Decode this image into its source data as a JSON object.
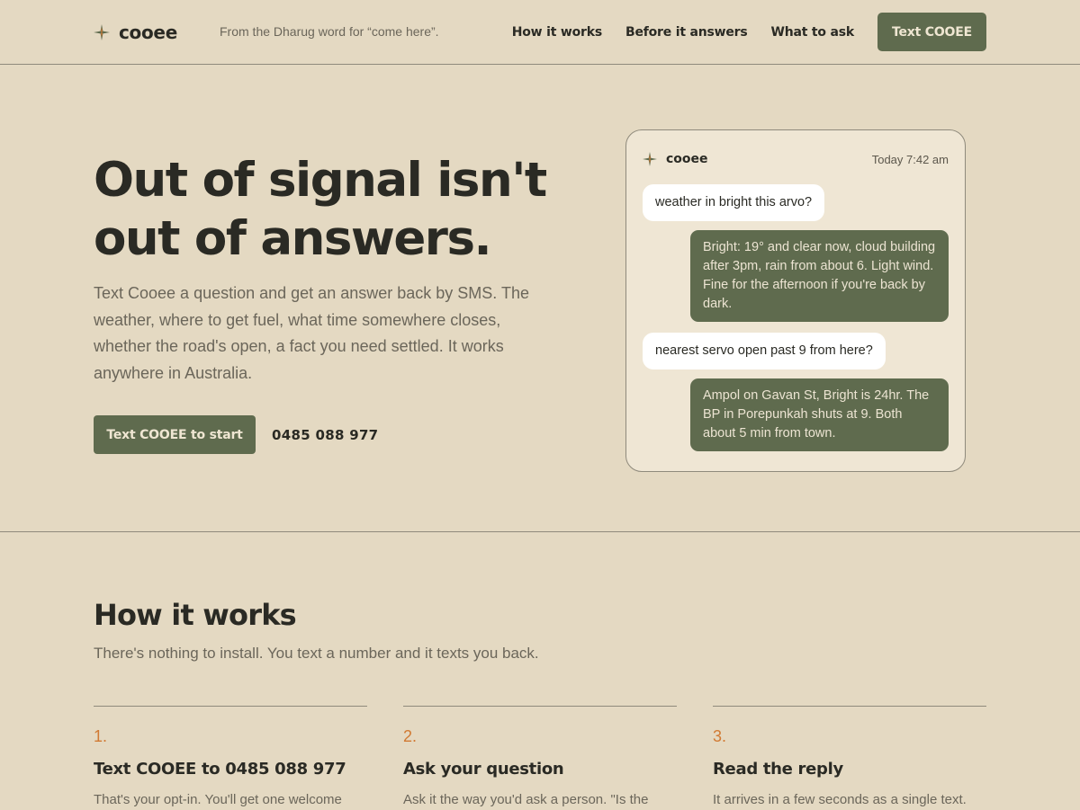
{
  "header": {
    "brand": "cooee",
    "brand_icon": "sparkle-icon",
    "tagline": "From the Dharug word for “come here”.",
    "nav": [
      {
        "label": "How it works"
      },
      {
        "label": "Before it answers"
      },
      {
        "label": "What to ask"
      }
    ],
    "cta_label": "Text COOEE"
  },
  "hero": {
    "title_line1": "Out of signal isn't",
    "title_line2": "out of answers.",
    "body": "Text Cooee a question and get an answer back by SMS. The weather, where to get fuel, what time somewhere closes, whether the road's open, a fact you need settled. It works anywhere in Australia.",
    "cta_label": "Text COOEE to start",
    "phone": "0485 088 977"
  },
  "chat": {
    "brand": "cooee",
    "time": "Today 7:42 am",
    "messages": [
      {
        "direction": "incoming",
        "text": "weather in bright this arvo?"
      },
      {
        "direction": "outgoing",
        "text": "Bright: 19° and clear now, cloud building after 3pm, rain from about 6. Light wind. Fine for the afternoon if you're back by dark."
      },
      {
        "direction": "incoming",
        "text": "nearest servo open past 9 from here?"
      },
      {
        "direction": "outgoing",
        "text": "Ampol on Gavan St, Bright is 24hr. The BP in Porepunkah shuts at 9. Both about 5 min from town."
      }
    ]
  },
  "how": {
    "title": "How it works",
    "subtitle": "There's nothing to install. You text a number and it texts you back.",
    "steps": [
      {
        "num": "1.",
        "title": "Text COOEE to 0485 088 977",
        "text": "That's your opt-in. You'll get one welcome"
      },
      {
        "num": "2.",
        "title": "Ask your question",
        "text": "Ask it the way you'd ask a person. \"Is the"
      },
      {
        "num": "3.",
        "title": "Read the reply",
        "text": "It arrives in a few seconds as a single text."
      }
    ]
  },
  "colors": {
    "background": "#e4d9c2",
    "card": "#efe6d4",
    "accent_green": "#5f6b4e",
    "accent_orange": "#d17a33",
    "text_dark": "#2a2a24",
    "text_muted": "#6b665a"
  }
}
